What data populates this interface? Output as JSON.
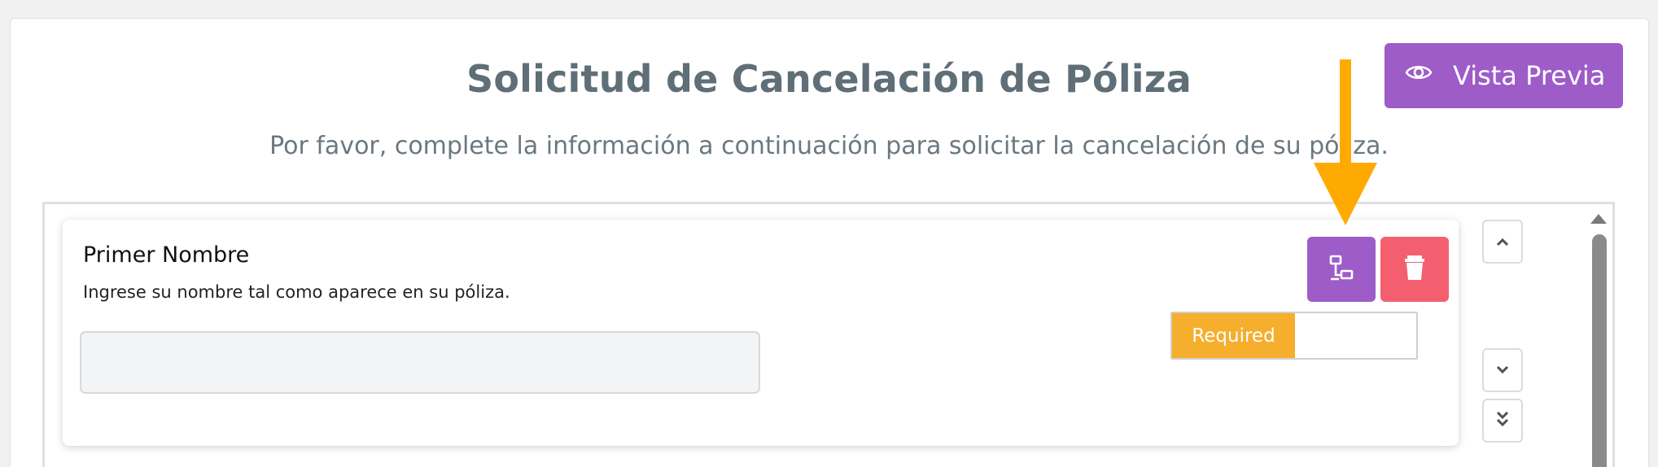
{
  "header": {
    "title": "Solicitud de Cancelación de Póliza",
    "subtitle": "Por favor, complete la información a continuación para solicitar la cancelación de su póliza.",
    "preview_button": {
      "label": "Vista Previa",
      "icon": "eye-icon"
    }
  },
  "field": {
    "label": "Primer Nombre",
    "help_text": "Ingrese su nombre tal como aparece en su póliza.",
    "input_value": "",
    "required_label": "Required",
    "logic_button_icon": "sitemap-icon",
    "delete_button_icon": "trash-icon",
    "move_buttons": [
      "chevron-up-icon",
      "chevron-down-icon",
      "double-chevron-down-icon"
    ]
  },
  "colors": {
    "accent_purple": "#9d5cc8",
    "delete_red": "#f45f6f",
    "required_orange": "#f6ae2d",
    "annotation_arrow": "#ffaa00"
  }
}
